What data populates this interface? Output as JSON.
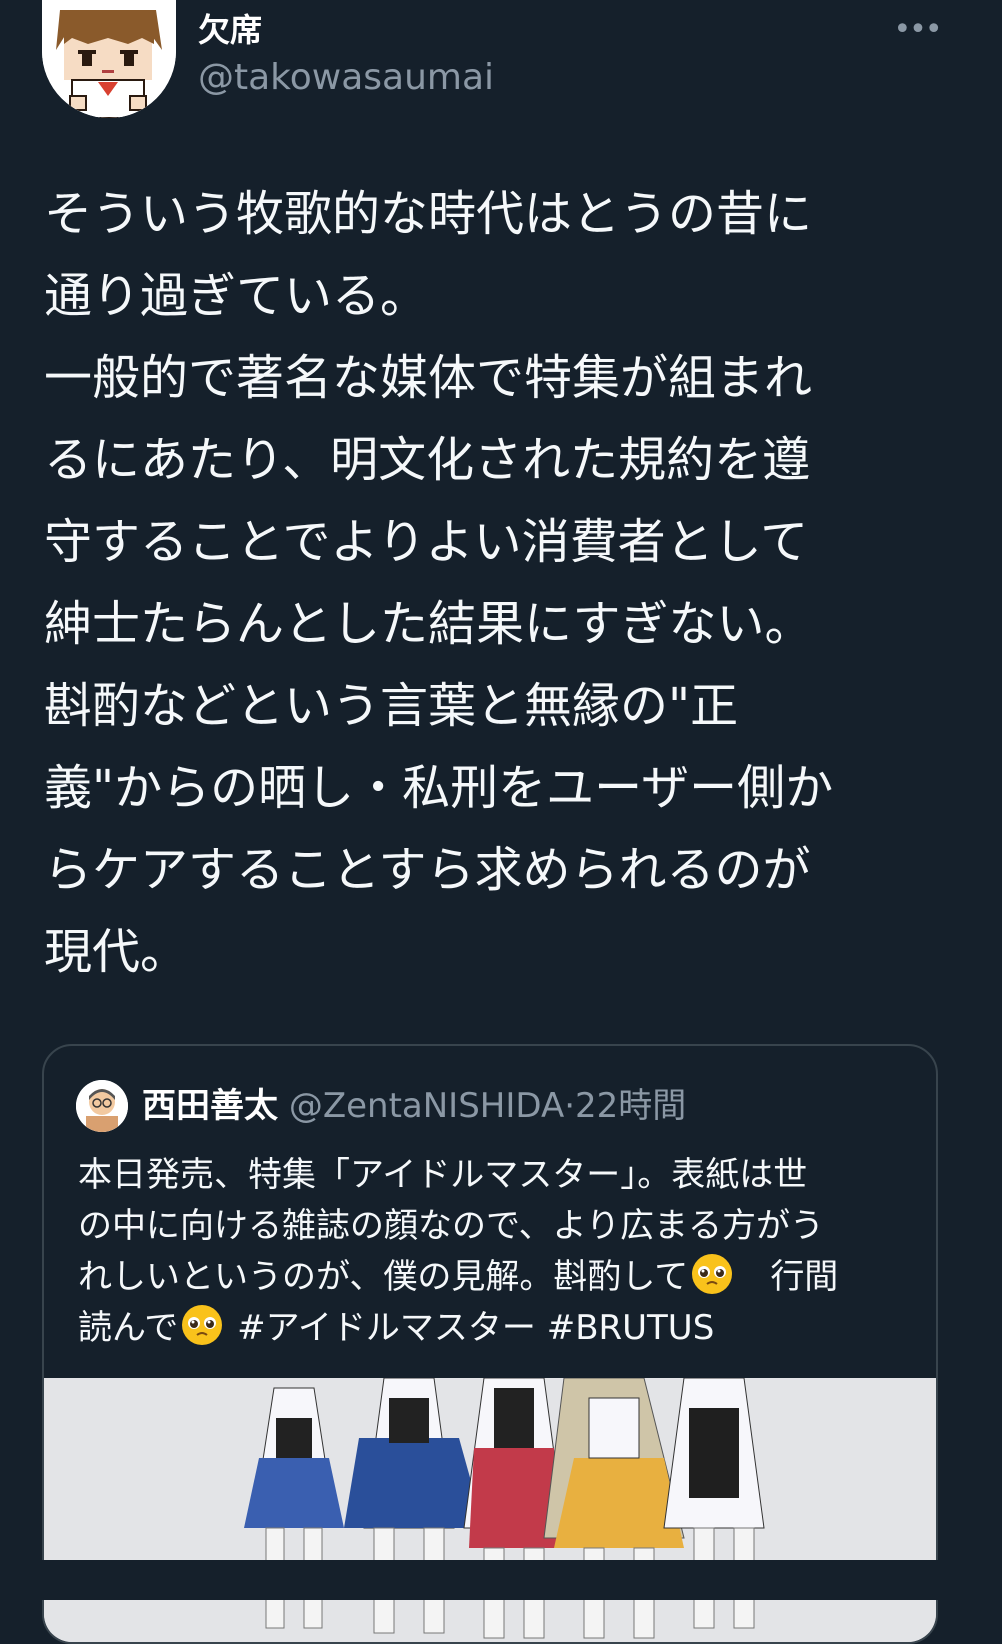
{
  "tweet": {
    "display_name": "欠席",
    "handle": "@takowasaumai",
    "more_icon": "•••",
    "body_lines": [
      "そういう牧歌的な時代はとうの昔に",
      "通り過ぎている。",
      "一般的で著名な媒体で特集が組まれ",
      "るにあたり、明文化された規約を遵",
      "守することでよりよい消費者として",
      "紳士たらんとした結果にすぎない。",
      "斟酌などという言葉と無縁の\"正",
      "義\"からの晒し・私刑をユーザー側か",
      "らケアすることすら求められるのが",
      "現代。"
    ]
  },
  "quoted_tweet": {
    "display_name": "西田善太",
    "handle": "@ZentaNISHIDA",
    "separator": "·",
    "time": "22時間",
    "line1": "本日発売、特集「アイドルマスター」。表紙は世",
    "line2": "の中に向ける雑誌の顔なので、より広まる方がう",
    "line3_a": "れしいというのが、僕の見解。斟酌して",
    "line3_b": "行間",
    "line4_a": "読んで",
    "line4_b": "#アイドルマスター #BRUTUS",
    "emoji_name": "pleading-face-emoji"
  },
  "colors": {
    "background": "#15202b",
    "text": "#f5f8fa",
    "secondary": "#8b98a5",
    "border": "#38444d",
    "emoji": "#f9c21b"
  }
}
